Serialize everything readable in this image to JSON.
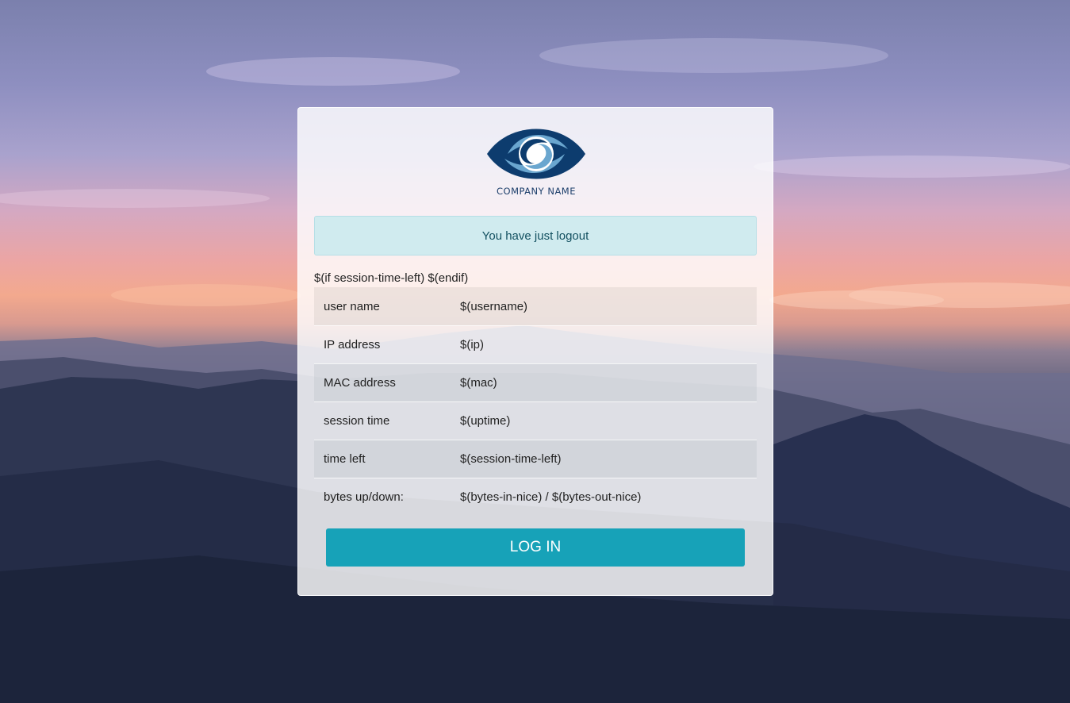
{
  "brand": {
    "company_name": "COMPANY NAME",
    "logo_icon": "eye-logo-icon",
    "colors": {
      "dark_blue": "#0d3c6e",
      "light_blue": "#6aa6cf"
    }
  },
  "alert": {
    "message": "You have just logout"
  },
  "template_line": "$(if session-time-left) $(endif)",
  "info_rows": [
    {
      "label": "user name",
      "value": "$(username)"
    },
    {
      "label": "IP address",
      "value": "$(ip)"
    },
    {
      "label": "MAC address",
      "value": "$(mac)"
    },
    {
      "label": "session time",
      "value": "$(uptime)"
    },
    {
      "label": "time left",
      "value": "$(session-time-left)"
    },
    {
      "label": "bytes up/down:",
      "value": "$(bytes-in-nice) / $(bytes-out-nice)"
    }
  ],
  "login_button": {
    "label": "LOG IN",
    "color": "#17a2b8"
  }
}
